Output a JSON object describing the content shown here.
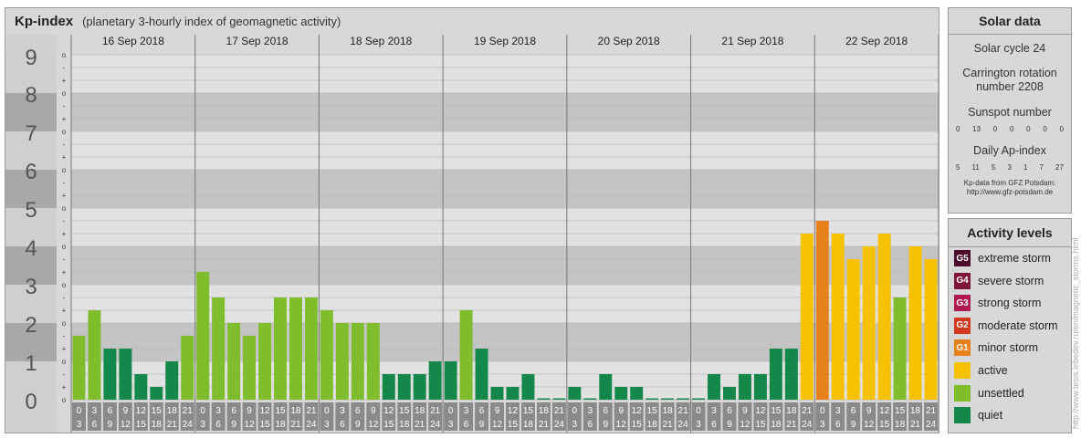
{
  "header": {
    "title": "Kp-index",
    "subtitle": "(planetary 3-hourly index of geomagnetic activity)"
  },
  "chart_data": {
    "type": "bar",
    "title": "Kp-index",
    "subtitle": "(planetary 3-hourly index of geomagnetic activity)",
    "ylim": [
      0,
      9
    ],
    "y_tick_labels": [
      "0",
      "1",
      "2",
      "3",
      "4",
      "5",
      "6",
      "7",
      "8",
      "9"
    ],
    "y_subtick_labels": [
      "o",
      "+",
      "-",
      "o"
    ],
    "days": [
      "16 Sep 2018",
      "17 Sep 2018",
      "18 Sep 2018",
      "19 Sep 2018",
      "20 Sep 2018",
      "21 Sep 2018",
      "22 Sep 2018"
    ],
    "interval_labels": [
      [
        "0",
        "3"
      ],
      [
        "3",
        "6"
      ],
      [
        "6",
        "9"
      ],
      [
        "9",
        "12"
      ],
      [
        "12",
        "15"
      ],
      [
        "15",
        "18"
      ],
      [
        "18",
        "21"
      ],
      [
        "21",
        "24"
      ]
    ],
    "values": [
      1.667,
      2.333,
      1.333,
      1.333,
      0.667,
      0.333,
      1.0,
      1.667,
      3.333,
      2.667,
      2.0,
      1.667,
      2.0,
      2.667,
      2.667,
      2.667,
      2.333,
      2.0,
      2.0,
      2.0,
      0.667,
      0.667,
      0.667,
      1.0,
      1.0,
      2.333,
      1.333,
      0.333,
      0.333,
      0.667,
      0.0,
      0.0,
      0.333,
      0.0,
      0.667,
      0.333,
      0.333,
      0.0,
      0.0,
      0.0,
      0.0,
      0.667,
      0.333,
      0.667,
      0.667,
      1.333,
      1.333,
      4.333,
      4.667,
      4.333,
      3.667,
      4.0,
      4.333,
      2.667,
      4.0,
      3.667
    ],
    "colors": {
      "quiet": "#13884a",
      "unsettled": "#7fbd2d",
      "active": "#f6c200",
      "minor": "#e5801a"
    },
    "grid": true
  },
  "solar": {
    "title": "Solar data",
    "solar_cycle": "Solar cycle 24",
    "carrington_line1": "Carrington rotation",
    "carrington_line2": "number 2208",
    "sunspot_title": "Sunspot number",
    "sunspots": [
      "0",
      "13",
      "0",
      "0",
      "0",
      "0",
      "0"
    ],
    "ap_title": "Daily Ap-index",
    "ap_values": [
      "5",
      "11",
      "5",
      "3",
      "1",
      "7",
      "27"
    ],
    "source_line1": "Kp-data from GFZ Potsdam:",
    "source_line2": "http://www.gfz-potsdam.de"
  },
  "activity": {
    "title": "Activity levels",
    "levels": [
      {
        "code": "G5",
        "label": "extreme storm",
        "color": "#4b0b2a"
      },
      {
        "code": "G4",
        "label": "severe storm",
        "color": "#80153a"
      },
      {
        "code": "G3",
        "label": "strong storm",
        "color": "#b01a52"
      },
      {
        "code": "G2",
        "label": "moderate storm",
        "color": "#d2391f"
      },
      {
        "code": "G1",
        "label": "minor storm",
        "color": "#e5801a"
      },
      {
        "code": "",
        "label": "active",
        "color": "#f6c200"
      },
      {
        "code": "",
        "label": "unsettled",
        "color": "#7fbd2d"
      },
      {
        "code": "",
        "label": "quiet",
        "color": "#13884a"
      }
    ]
  },
  "watermark": "http://www.tesis.lebedev.ru/en/magnetic_storms.html"
}
